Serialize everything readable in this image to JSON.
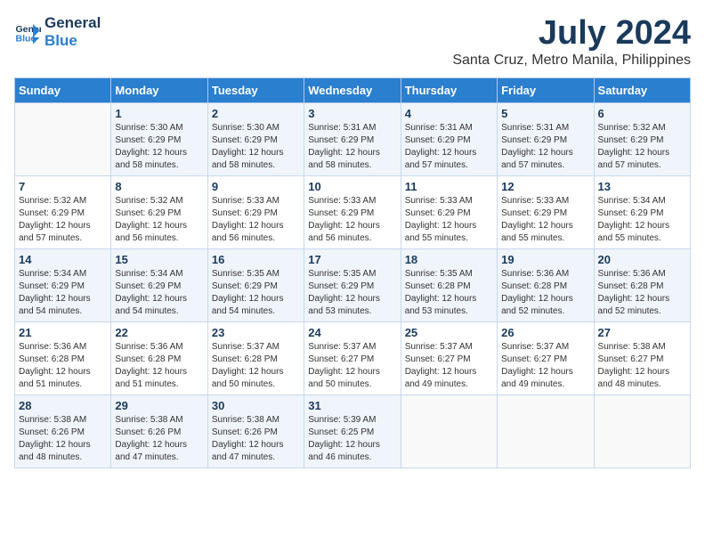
{
  "header": {
    "logo_line1": "General",
    "logo_line2": "Blue",
    "title": "July 2024",
    "subtitle": "Santa Cruz, Metro Manila, Philippines"
  },
  "calendar": {
    "days_of_week": [
      "Sunday",
      "Monday",
      "Tuesday",
      "Wednesday",
      "Thursday",
      "Friday",
      "Saturday"
    ],
    "weeks": [
      [
        {
          "num": "",
          "info": ""
        },
        {
          "num": "1",
          "info": "Sunrise: 5:30 AM\nSunset: 6:29 PM\nDaylight: 12 hours\nand 58 minutes."
        },
        {
          "num": "2",
          "info": "Sunrise: 5:30 AM\nSunset: 6:29 PM\nDaylight: 12 hours\nand 58 minutes."
        },
        {
          "num": "3",
          "info": "Sunrise: 5:31 AM\nSunset: 6:29 PM\nDaylight: 12 hours\nand 58 minutes."
        },
        {
          "num": "4",
          "info": "Sunrise: 5:31 AM\nSunset: 6:29 PM\nDaylight: 12 hours\nand 57 minutes."
        },
        {
          "num": "5",
          "info": "Sunrise: 5:31 AM\nSunset: 6:29 PM\nDaylight: 12 hours\nand 57 minutes."
        },
        {
          "num": "6",
          "info": "Sunrise: 5:32 AM\nSunset: 6:29 PM\nDaylight: 12 hours\nand 57 minutes."
        }
      ],
      [
        {
          "num": "7",
          "info": "Sunrise: 5:32 AM\nSunset: 6:29 PM\nDaylight: 12 hours\nand 57 minutes."
        },
        {
          "num": "8",
          "info": "Sunrise: 5:32 AM\nSunset: 6:29 PM\nDaylight: 12 hours\nand 56 minutes."
        },
        {
          "num": "9",
          "info": "Sunrise: 5:33 AM\nSunset: 6:29 PM\nDaylight: 12 hours\nand 56 minutes."
        },
        {
          "num": "10",
          "info": "Sunrise: 5:33 AM\nSunset: 6:29 PM\nDaylight: 12 hours\nand 56 minutes."
        },
        {
          "num": "11",
          "info": "Sunrise: 5:33 AM\nSunset: 6:29 PM\nDaylight: 12 hours\nand 55 minutes."
        },
        {
          "num": "12",
          "info": "Sunrise: 5:33 AM\nSunset: 6:29 PM\nDaylight: 12 hours\nand 55 minutes."
        },
        {
          "num": "13",
          "info": "Sunrise: 5:34 AM\nSunset: 6:29 PM\nDaylight: 12 hours\nand 55 minutes."
        }
      ],
      [
        {
          "num": "14",
          "info": "Sunrise: 5:34 AM\nSunset: 6:29 PM\nDaylight: 12 hours\nand 54 minutes."
        },
        {
          "num": "15",
          "info": "Sunrise: 5:34 AM\nSunset: 6:29 PM\nDaylight: 12 hours\nand 54 minutes."
        },
        {
          "num": "16",
          "info": "Sunrise: 5:35 AM\nSunset: 6:29 PM\nDaylight: 12 hours\nand 54 minutes."
        },
        {
          "num": "17",
          "info": "Sunrise: 5:35 AM\nSunset: 6:29 PM\nDaylight: 12 hours\nand 53 minutes."
        },
        {
          "num": "18",
          "info": "Sunrise: 5:35 AM\nSunset: 6:28 PM\nDaylight: 12 hours\nand 53 minutes."
        },
        {
          "num": "19",
          "info": "Sunrise: 5:36 AM\nSunset: 6:28 PM\nDaylight: 12 hours\nand 52 minutes."
        },
        {
          "num": "20",
          "info": "Sunrise: 5:36 AM\nSunset: 6:28 PM\nDaylight: 12 hours\nand 52 minutes."
        }
      ],
      [
        {
          "num": "21",
          "info": "Sunrise: 5:36 AM\nSunset: 6:28 PM\nDaylight: 12 hours\nand 51 minutes."
        },
        {
          "num": "22",
          "info": "Sunrise: 5:36 AM\nSunset: 6:28 PM\nDaylight: 12 hours\nand 51 minutes."
        },
        {
          "num": "23",
          "info": "Sunrise: 5:37 AM\nSunset: 6:28 PM\nDaylight: 12 hours\nand 50 minutes."
        },
        {
          "num": "24",
          "info": "Sunrise: 5:37 AM\nSunset: 6:27 PM\nDaylight: 12 hours\nand 50 minutes."
        },
        {
          "num": "25",
          "info": "Sunrise: 5:37 AM\nSunset: 6:27 PM\nDaylight: 12 hours\nand 49 minutes."
        },
        {
          "num": "26",
          "info": "Sunrise: 5:37 AM\nSunset: 6:27 PM\nDaylight: 12 hours\nand 49 minutes."
        },
        {
          "num": "27",
          "info": "Sunrise: 5:38 AM\nSunset: 6:27 PM\nDaylight: 12 hours\nand 48 minutes."
        }
      ],
      [
        {
          "num": "28",
          "info": "Sunrise: 5:38 AM\nSunset: 6:26 PM\nDaylight: 12 hours\nand 48 minutes."
        },
        {
          "num": "29",
          "info": "Sunrise: 5:38 AM\nSunset: 6:26 PM\nDaylight: 12 hours\nand 47 minutes."
        },
        {
          "num": "30",
          "info": "Sunrise: 5:38 AM\nSunset: 6:26 PM\nDaylight: 12 hours\nand 47 minutes."
        },
        {
          "num": "31",
          "info": "Sunrise: 5:39 AM\nSunset: 6:25 PM\nDaylight: 12 hours\nand 46 minutes."
        },
        {
          "num": "",
          "info": ""
        },
        {
          "num": "",
          "info": ""
        },
        {
          "num": "",
          "info": ""
        }
      ]
    ]
  }
}
